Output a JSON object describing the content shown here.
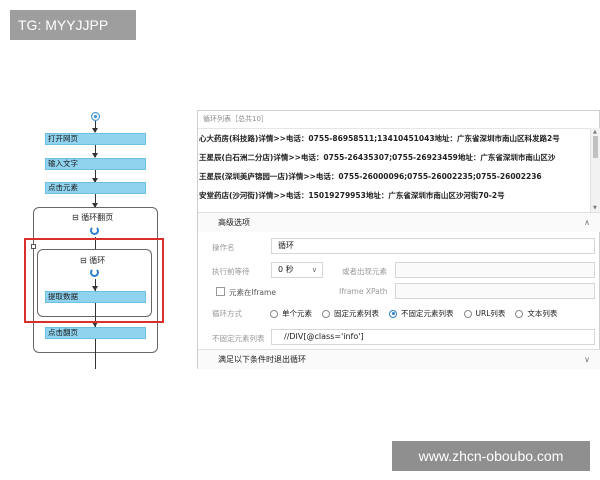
{
  "badges": {
    "tag": "TG: MYYJJPP",
    "site": "www.zhcn-oboubo.com"
  },
  "flow": {
    "steps": {
      "open_page": "打开网页",
      "input_text": "输入文字",
      "click_element": "点击元素",
      "extract_data": "提取数据",
      "click_next": "点击翻页"
    },
    "loop_outer_title": "循环翻页",
    "loop_inner_title": "循环",
    "collapse_glyph": "⊟"
  },
  "panel": {
    "list_header": "循环列表［总共10］",
    "list_items": [
      "心大药房(科技路)详情>>电话：0755-86958511;13410451043地址：广东省深圳市南山区科发路2号",
      "王星辰(白石洲二分店)详情>>电话：0755-26435307;0755-26923459地址：广东省深圳市南山区沙",
      "王星辰(深圳美庐锦园一店)详情>>电话：0755-26000096;0755-26002235;0755-26002236",
      "安堂药店(沙河街)详情>>电话：15019279953地址：广东省深圳市南山区沙河街70-2号"
    ],
    "advanced_title": "高级选项",
    "op_name_label": "操作名",
    "op_name_value": "循环",
    "wait_label": "执行前等待",
    "wait_value": "0 秒",
    "appear_label": "或者出现元素",
    "in_iframe_label": "元素在Iframe",
    "iframe_xpath_label": "Iframe XPath",
    "loop_mode_label": "循环方式",
    "loop_modes": [
      "单个元素",
      "固定元素列表",
      "不固定元素列表",
      "URL列表",
      "文本列表"
    ],
    "selected_mode": "不固定元素列表",
    "unfixed_list_label": "不固定元素列表",
    "unfixed_list_value": "//DIV[@class='info']",
    "exit_section_title": "满足以下条件时退出循环",
    "chevron_up": "∧",
    "chevron_down": "∨"
  },
  "colors": {
    "step_fill": "#8fd3ef",
    "highlight_border": "#d9302c",
    "accent": "#2f7fc9"
  }
}
